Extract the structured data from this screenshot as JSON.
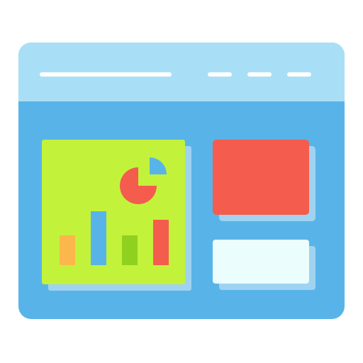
{
  "icon": {
    "name": "dashboard-window-icon",
    "colors": {
      "window_body": "#58b4e8",
      "title_bar": "#a8dff7",
      "title_bar_lines": "#ffffff",
      "card_shadow": "#9fd3f1",
      "chart_card": "#c3f23b",
      "red_card": "#f45c4d",
      "white_card": "#ebfdfc",
      "bar_orange": "#fbb74c",
      "bar_blue": "#58b4e8",
      "bar_green": "#8fd11e",
      "bar_red": "#f45c4d",
      "pie_main": "#f45c4d",
      "pie_slice": "#58b4e8"
    },
    "bars": [
      {
        "name": "bar-orange",
        "color_key": "bar_orange",
        "value": 0.42
      },
      {
        "name": "bar-blue",
        "color_key": "bar_blue",
        "value": 0.76
      },
      {
        "name": "bar-green",
        "color_key": "bar_green",
        "value": 0.42
      },
      {
        "name": "bar-red",
        "color_key": "bar_red",
        "value": 0.64
      }
    ]
  }
}
